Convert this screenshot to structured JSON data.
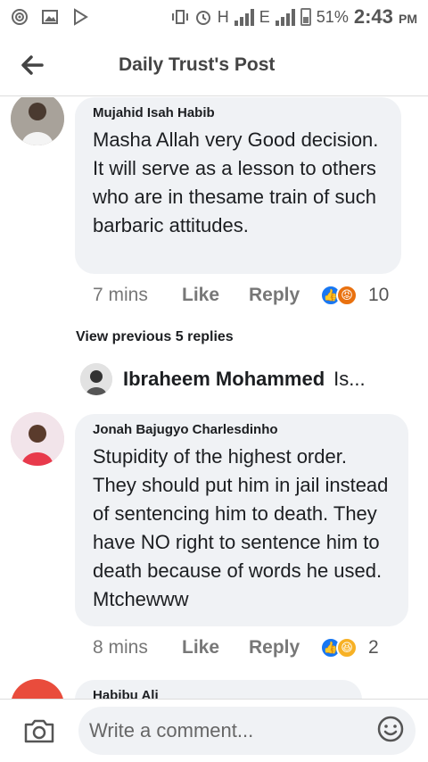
{
  "status_bar": {
    "network_label_h": "H",
    "network_label_e": "E",
    "battery": "51%",
    "time": "2:43",
    "ampm": "PM"
  },
  "header": {
    "title": "Daily Trust's Post"
  },
  "comments": [
    {
      "author": "Mujahid Isah Habib",
      "text": "Masha Allah very Good decision. It will serve as a lesson to others who are in thesame train of such barbaric attitudes.",
      "time": "7 mins",
      "like_label": "Like",
      "reply_label": "Reply",
      "reaction_count": "10",
      "reactions": [
        "like-icon",
        "angry-icon"
      ]
    },
    {
      "author": "Jonah Bajugyo Charlesdinho",
      "text": "Stupidity of the highest order. They should put him in jail instead of sentencing him to death. They have NO right to sentence him to death because of words he used. Mtchewww",
      "time": "8 mins",
      "like_label": "Like",
      "reply_label": "Reply",
      "reaction_count": "2",
      "reactions": [
        "like-icon",
        "haha-icon"
      ]
    },
    {
      "author": "Habibu Ali"
    }
  ],
  "view_previous": "View previous 5 replies",
  "reply_preview": {
    "name": "Ibraheem Mohammed",
    "snippet": "Is..."
  },
  "composer": {
    "placeholder": "Write a comment..."
  },
  "colors": {
    "bubble": "#f0f2f5",
    "like_blue": "#1877f2",
    "angry_orange": "#e9710f",
    "haha_yellow": "#f7b125"
  }
}
